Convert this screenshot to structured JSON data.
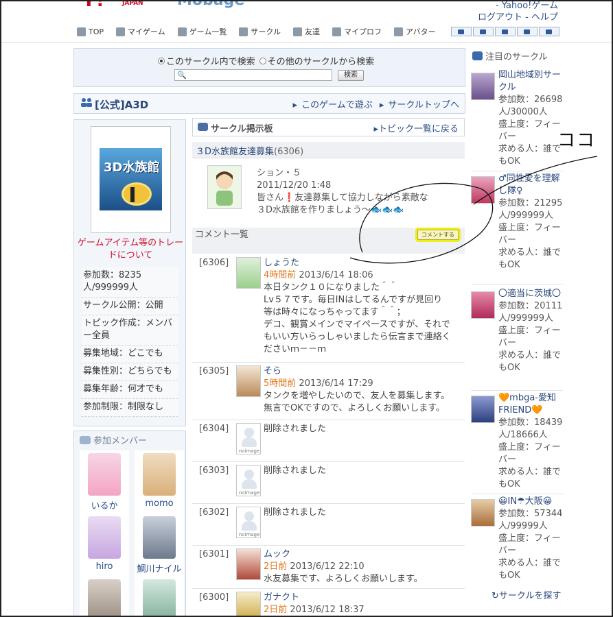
{
  "header": {
    "logo_text": "Y!",
    "logo_sub": "JAPAN",
    "logo_rest": "Mobage",
    "top_link": "- Yahoo!ゲーム",
    "logout": "ログアウト",
    "help": "ヘルプ"
  },
  "nav": {
    "items": [
      "TOP",
      "マイゲーム",
      "ゲーム一覧",
      "サークル",
      "友達",
      "マイプロフ",
      "アバター"
    ],
    "icons": [
      "house-icon",
      "my-game-icon",
      "game-list-icon",
      "circle-icon",
      "friends-icon",
      "profile-icon",
      "avatar-icon"
    ],
    "mini_icons": [
      "chat-icon",
      "mail-icon",
      "bag-icon",
      "list-icon",
      "glasses-icon"
    ]
  },
  "search": {
    "opt1": "このサークル内で検索",
    "opt2": "その他のサークルから検索",
    "button": "検索",
    "value": ""
  },
  "circle": {
    "title": "[公式]A3D",
    "link_play": "このゲームで遊ぶ",
    "link_top": "サークルトップへ"
  },
  "left": {
    "game_title": "3D水族館",
    "trade_link": "ゲームアイテム等のトレードについて",
    "info": [
      "参加数：8235人/999999人",
      "サークル公開：公開",
      "トピック作成：メンバー全員",
      "募集地域：どこでも",
      "募集性別：どちらでも",
      "募集年齢：何才でも",
      "参加制限：制限なし"
    ]
  },
  "members": {
    "heading": "参加メンバー",
    "list": [
      {
        "name": "いるか",
        "color": "#f3a4c4"
      },
      {
        "name": "momo",
        "color": "#d9b07a"
      },
      {
        "name": "hiro",
        "color": "#c7a6e0"
      },
      {
        "name": "鯛川ナイル",
        "color": "#6d7a8c"
      },
      {
        "name": "",
        "color": "#9a8c80"
      },
      {
        "name": "",
        "color": "#7fae9a"
      }
    ]
  },
  "board": {
    "title": "サークル掲示板",
    "back_link": "トピック一覧に戻る",
    "topic_title": "３D水族館友達募集",
    "topic_count": "(6306)",
    "post": {
      "author": "ション・５",
      "date": "2011/12/20 1:48",
      "line1": "皆さん❗友達募集して協力しながら素敵な",
      "line2": "３D水族館を作りましょう〜🐟🐟🐟"
    },
    "comment_heading": "コメント一覧",
    "comment_button": "コメントする"
  },
  "comments": [
    {
      "no": "[6306]",
      "name": "しょうた",
      "ago": "4時間前",
      "date": "2013/6/14 18:06",
      "lines": [
        "本日タンク１０になりました＾＾",
        "Lv５７です。毎日INはしてるんですが見回り",
        "等は時々になっちゃってます＾＾；",
        "デコ、観賞メインでマイペースですが、それで",
        "もいい方いらっしゃいましたら伝言まで連絡く",
        "ださいｍ－－ｍ"
      ]
    },
    {
      "no": "[6305]",
      "name": "そら",
      "ago": "5時間前",
      "date": "2013/6/14 17:29",
      "lines": [
        "タンクを増やしたいので、友人を募集します。",
        "無言でOKですので、よろしくお願いします。"
      ]
    },
    {
      "no": "[6304]",
      "deleted": "削除されました"
    },
    {
      "no": "[6303]",
      "deleted": "削除されました"
    },
    {
      "no": "[6302]",
      "deleted": "削除されました"
    },
    {
      "no": "[6301]",
      "name": "ムック",
      "ago": "2日前",
      "date": "2013/6/12 22:10",
      "lines": [
        "水友募集です、よろしくお願いします。"
      ]
    },
    {
      "no": "[6300]",
      "name": "ガナクト",
      "ago": "2日前",
      "date": "2013/6/12 18:37",
      "lines": []
    }
  ],
  "noimage_label": "noimage",
  "right": {
    "heading": "注目のサークル",
    "circles": [
      {
        "name": "岡山地域別サークル",
        "count": "参加数：26698人/30000人",
        "level": "盛上度：フィーバー",
        "wanted": "求める人：誰でもOK",
        "color": "#6b4f8a"
      },
      {
        "name": "♂同性愛を理解し隊♀",
        "count": "参加数：21295人/999999人",
        "level": "盛上度：フィーバー",
        "wanted": "求める人：誰でもOK",
        "color": "#c0395e"
      },
      {
        "name": "〇適当に茨城〇",
        "count": "参加数：20111人/999999人",
        "level": "盛上度：フィーバー",
        "wanted": "求める人：誰でもOK",
        "color": "#b02a5a"
      },
      {
        "name": "🧡mbga-愛知FRIEND🧡",
        "count": "参加数：18439人/18666人",
        "level": "盛上度：フィーバー",
        "wanted": "求める人：誰でもOK",
        "color": "#2b3f7e"
      },
      {
        "name": "😀IN☂大阪😀",
        "count": "参加数：57344人/99999人",
        "level": "盛上度：フィーバー",
        "wanted": "求める人：誰でもOK",
        "color": "#a86f3a"
      }
    ],
    "search_link": "サークルを探す"
  },
  "annotation": {
    "text": "ココ"
  }
}
